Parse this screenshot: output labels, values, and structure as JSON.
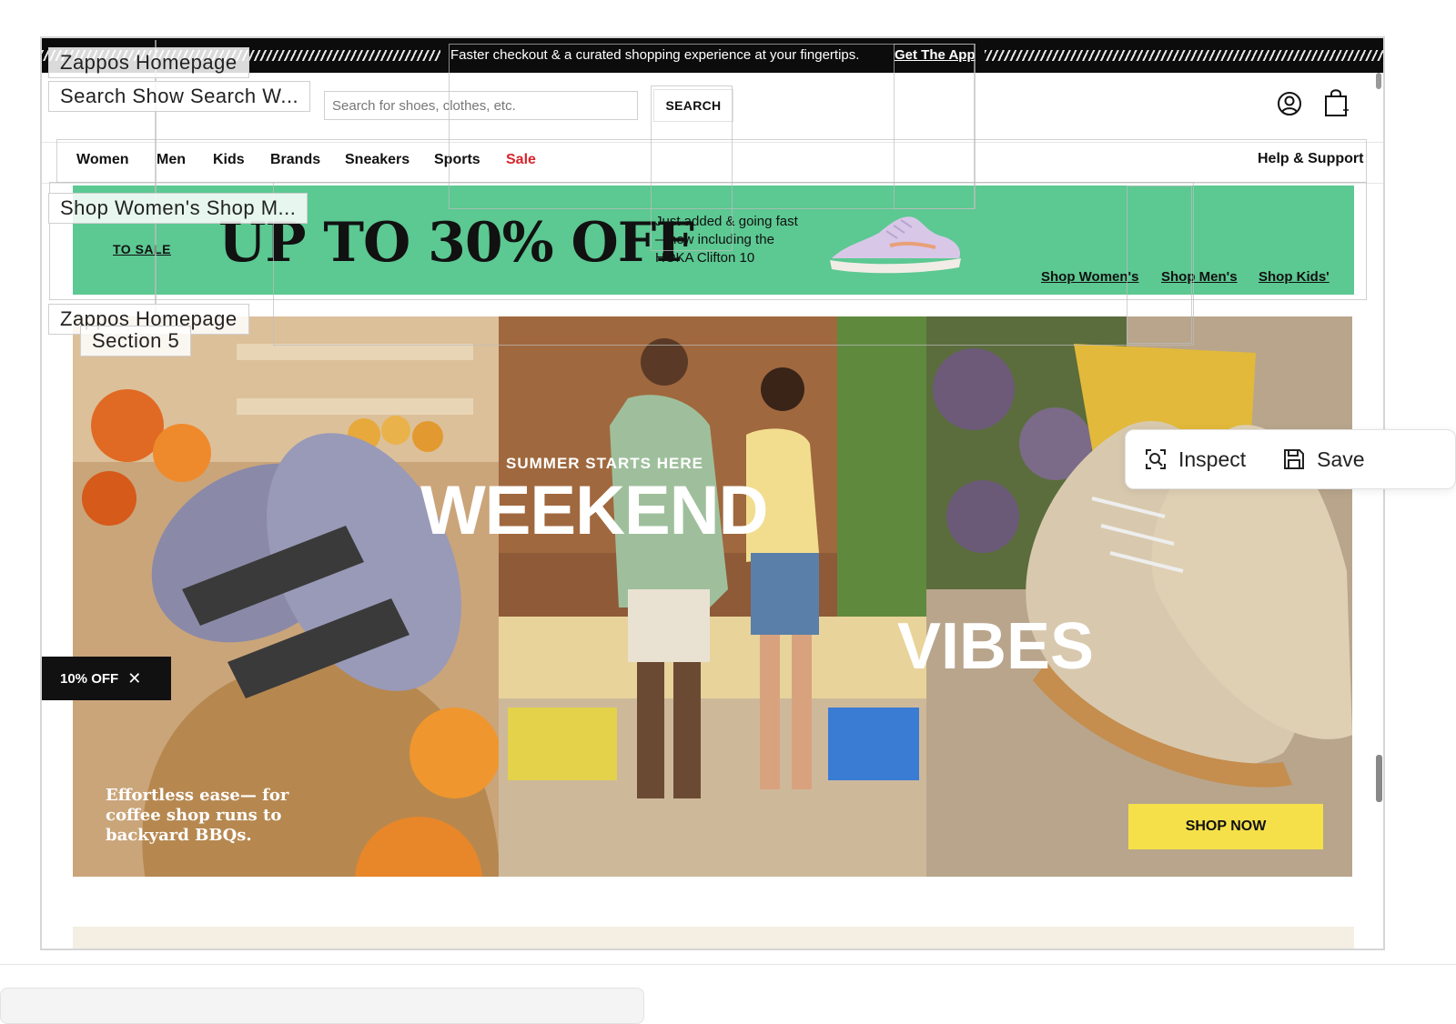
{
  "topbar": {
    "promo_text": "Faster checkout & a curated shopping experience at your fingertips.",
    "get_app": "Get The App"
  },
  "search": {
    "placeholder": "Search for shoes, clothes, etc.",
    "button": "SEARCH"
  },
  "icons": {
    "account": "account-icon",
    "bag": "shopping-bag-icon",
    "inspect": "inspect-icon",
    "save": "save-icon",
    "close": "close-icon"
  },
  "nav": {
    "items": [
      "Women",
      "Men",
      "Kids",
      "Brands",
      "Sneakers",
      "Sports",
      "Sale"
    ],
    "help": "Help & Support"
  },
  "banner": {
    "to_sale": "TO SALE",
    "headline": "UP TO 30% OFF",
    "subtext": "Just added & going fast—now including the HOKA Clifton 10",
    "links": [
      "Shop Women's",
      "Shop Men's",
      "Shop Kids'"
    ]
  },
  "hero": {
    "eyebrow": "SUMMER STARTS HERE",
    "word1": "WEEKEND",
    "word2": "VIBES",
    "tagline": "Effortless ease— for coffee shop runs to backyard BBQs.",
    "cta": "SHOP NOW"
  },
  "discount_tab": {
    "label": "10% OFF"
  },
  "overlay_labels": {
    "l1": "Zappos Homepage",
    "l2": "Search Show Search W...",
    "l3": "Shop Women's Shop M...",
    "l4": "Zappos Homepage",
    "l5": "Section 5"
  },
  "toolbox": {
    "inspect": "Inspect",
    "save": "Save"
  },
  "colors": {
    "banner_green": "#5cc892",
    "sale_red": "#d8262c",
    "cta_yellow": "#f5e04a",
    "topbar_black": "#0c0c0c"
  }
}
